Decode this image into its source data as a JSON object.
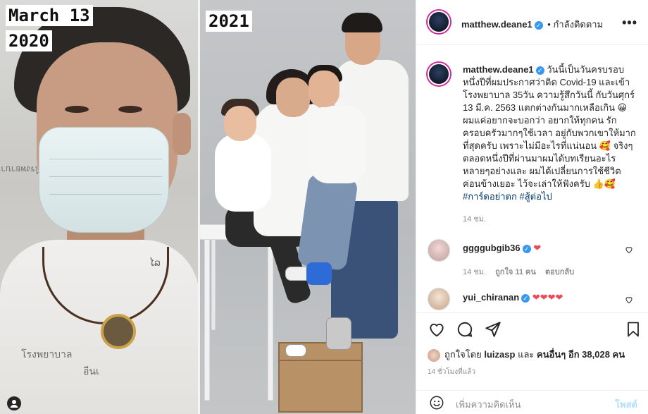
{
  "image": {
    "left_date_line1": "March 13",
    "left_date_line2": "2020",
    "right_year": "2021",
    "gown_text_1": "โรงพยาบาล",
    "gown_text_2": "อีนเ",
    "gown_text_3": "ໄລ",
    "gown_text_top": "ไรงพยาบาล"
  },
  "header": {
    "username": "matthew.deane1",
    "verified_icon": "check-badge-icon",
    "separator": "•",
    "follow_status": "กำลังติดตาม",
    "more_icon": "more-horizontal-icon",
    "more_glyph": "•••"
  },
  "caption": {
    "username": "matthew.deane1",
    "text_part1": " วันนี้เป็นวันครบรอบหนึ่งปีที่ผมประกาศว่าติด Covid-19 และเข้าโรงพยาบาล 35วัน ความรู้สึกวันนี้ กับวันศุกร์ 13 มี.ค. 2563 แตกต่างกันมากเหลือเกิน 😀 ผมแค่อยากจะบอกว่า อยากให้ทุกคน รักครอบครัวมากๆใช้เวลา อยู่กับพวกเขาให้มากที่สุดครับ เพราะไม่มีอะไรที่แน่นอน 🥰 จริงๆตลอดหนึ่งปีที่ผ่านมาผมได้บทเรียนอะไรหลายๆอย่างและ ผมได้เปลี่ยนการใช้ชีวิตค่อนข้างเยอะ ไว้จะเล่าให้ฟังครับ 👍🥰 ",
    "hashtag1": "#การ์ดอย่าตก",
    "hashtag2": "#สู้ต่อไป",
    "time": "14 ชม."
  },
  "comments": [
    {
      "username": "ggggubgib36",
      "verified": true,
      "text": "❤",
      "time": "14 ชม.",
      "likes": "ถูกใจ 11 คน",
      "reply": "ตอบกลับ",
      "like_icon": "heart-outline-icon"
    },
    {
      "username": "yui_chiranan",
      "verified": true,
      "text": "❤❤❤❤",
      "like_icon": "heart-outline-icon"
    }
  ],
  "actions": {
    "like_icon": "heart-outline-icon",
    "comment_icon": "comment-bubble-icon",
    "share_icon": "paper-plane-icon",
    "save_icon": "bookmark-icon",
    "liked_prefix": "ถูกใจโดย ",
    "liked_user": "luizasp",
    "liked_middle": " และ ",
    "liked_others": "คนอื่นๆ อีก 38,028 คน",
    "post_time": "14 ชั่วโมงที่แล้ว"
  },
  "add_comment": {
    "emoji_icon": "smiley-icon",
    "placeholder": "เพิ่มความคิดเห็น",
    "post_label": "โพสต์"
  },
  "colors": {
    "link_blue": "#00376b",
    "verified_blue": "#3897f0",
    "heart_red": "#ed4956",
    "post_disabled": "#b2dffc",
    "muted": "#8e8e8e"
  }
}
